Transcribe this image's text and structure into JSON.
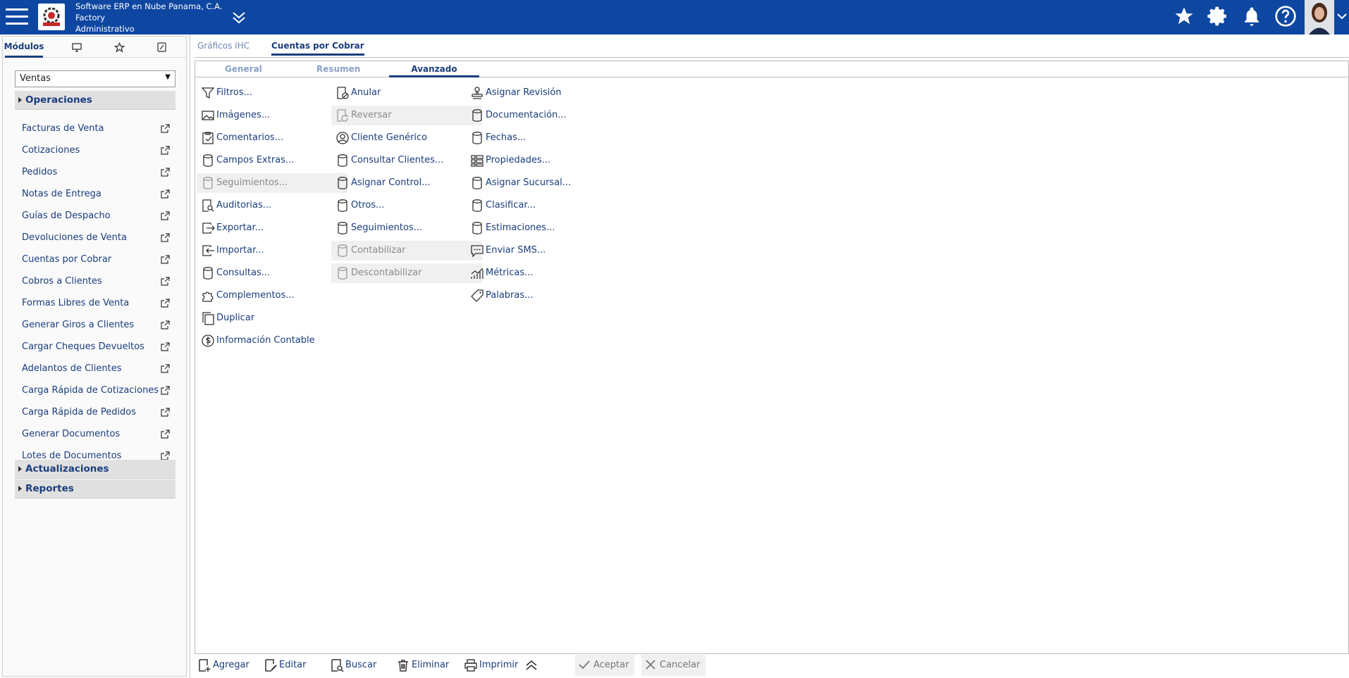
{
  "header": {
    "company_line1": "Software ERP en Nube Panama, C.A.",
    "company_line2": "Factory",
    "company_line3": "Administrativo"
  },
  "left_tabs": {
    "modulos_label": "Módulos"
  },
  "module_select": {
    "value": "Ventas"
  },
  "sections": {
    "operaciones": "Operaciones",
    "actualizaciones": "Actualizaciones",
    "reportes": "Reportes"
  },
  "menu_items": [
    "Facturas de Venta",
    "Cotizaciones",
    "Pedidos",
    "Notas de Entrega",
    "Guías de Despacho",
    "Devoluciones de Venta",
    "Cuentas por Cobrar",
    "Cobros a Clientes",
    "Formas Libres de Venta",
    "Generar Giros a Clientes",
    "Cargar Cheques Devueltos",
    "Adelantos de Clientes",
    "Carga Rápida de Cotizaciones",
    "Carga Rápida de Pedidos",
    "Generar Documentos",
    "Lotes de Documentos"
  ],
  "main_tabs": [
    "Gráficos IHC",
    "Cuentas por Cobrar"
  ],
  "sub_tabs": [
    "General",
    "Resumen",
    "Avanzado"
  ],
  "actions": {
    "col1": [
      "Filtros...",
      "Imágenes...",
      "Comentarios...",
      "Campos Extras...",
      "Seguimientos...",
      "Auditorias...",
      "Exportar...",
      "Importar...",
      "Consultas...",
      "Complementos...",
      "Duplicar",
      "Información Contable"
    ],
    "col2": [
      "Anular",
      "Reversar",
      "Cliente Genérico",
      "Consultar Clientes...",
      "Asignar Control...",
      "Otros...",
      "Seguimientos...",
      "Contabilizar",
      "Descontabilizar"
    ],
    "col3": [
      "Asignar Revisión",
      "Documentación...",
      "Fechas...",
      "Propiedades...",
      "Asignar Sucursal...",
      "Clasificar...",
      "Estimaciones...",
      "Enviar SMS...",
      "Métricas...",
      "Palabras..."
    ]
  },
  "toolbar": {
    "agregar": "Agregar",
    "editar": "Editar",
    "buscar": "Buscar",
    "eliminar": "Eliminar",
    "imprimir": "Imprimir",
    "aceptar": "Aceptar",
    "cancelar": "Cancelar"
  }
}
